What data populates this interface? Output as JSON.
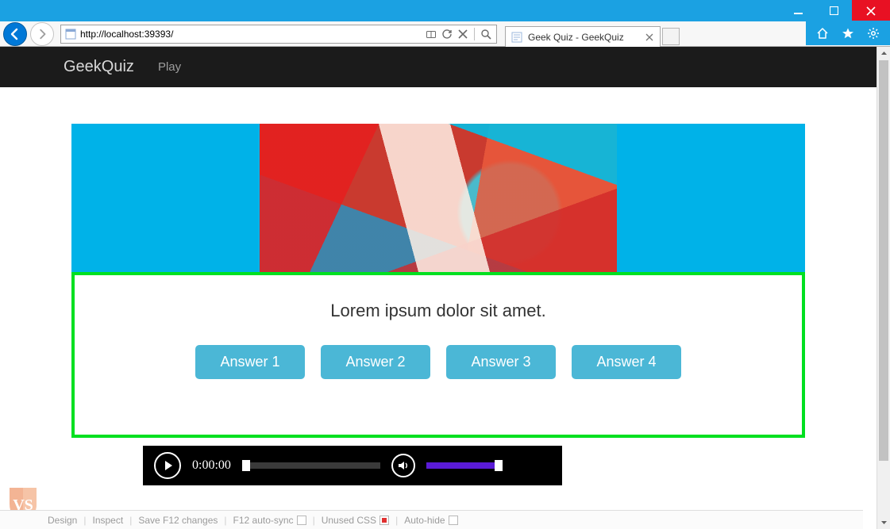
{
  "window": {
    "min_tooltip": "Minimize",
    "max_tooltip": "Maximize",
    "close_tooltip": "Close"
  },
  "browser": {
    "url": "http://localhost:39393/",
    "tab_title": "Geek Quiz - GeekQuiz"
  },
  "page": {
    "brand": "GeekQuiz",
    "nav_play": "Play",
    "question": "Lorem ipsum dolor sit amet.",
    "answers": [
      "Answer 1",
      "Answer 2",
      "Answer 3",
      "Answer 4"
    ]
  },
  "player": {
    "timecode": "0:00:00"
  },
  "devbar": {
    "design": "Design",
    "inspect": "Inspect",
    "save": "Save F12 changes",
    "autosync": "F12 auto-sync",
    "unused": "Unused CSS",
    "autohide": "Auto-hide"
  }
}
